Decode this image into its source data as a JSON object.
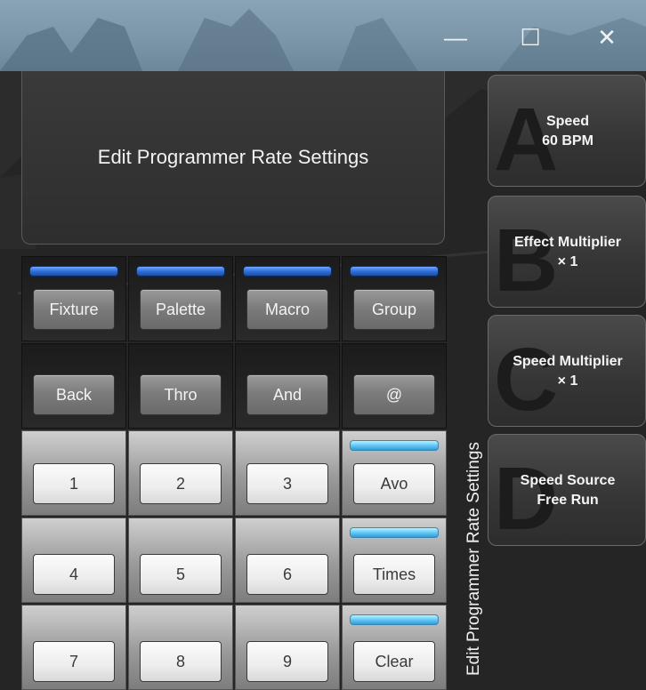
{
  "window": {
    "controls": {
      "minimize_icon": "minimize-icon",
      "maximize_icon": "maximize-icon",
      "close_icon": "close-icon"
    }
  },
  "header": {
    "title": "Edit Programmer Rate Settings"
  },
  "keypad": {
    "row1": [
      "Fixture",
      "Palette",
      "Macro",
      "Group"
    ],
    "row2": [
      "Back",
      "Thro",
      "And",
      "@"
    ],
    "row3": [
      "1",
      "2",
      "3",
      "Avo"
    ],
    "row4": [
      "4",
      "5",
      "6",
      "Times"
    ],
    "row5": [
      "7",
      "8",
      "9",
      "Clear"
    ]
  },
  "side_label": "Edit Programmer Rate Settings",
  "softkeys": [
    {
      "letter": "A",
      "line1": "Speed",
      "line2": "60 BPM"
    },
    {
      "letter": "B",
      "line1": "Effect Multiplier",
      "line2": "× 1"
    },
    {
      "letter": "C",
      "line1": "Speed Multiplier",
      "line2": "× 1"
    },
    {
      "letter": "D",
      "line1": "Speed Source",
      "line2": "Free Run"
    }
  ],
  "colors": {
    "led_blue": "#2f6fd8",
    "led_light_blue": "#64c8f5",
    "titlebar": "#7a95a8",
    "background": "#252525"
  }
}
